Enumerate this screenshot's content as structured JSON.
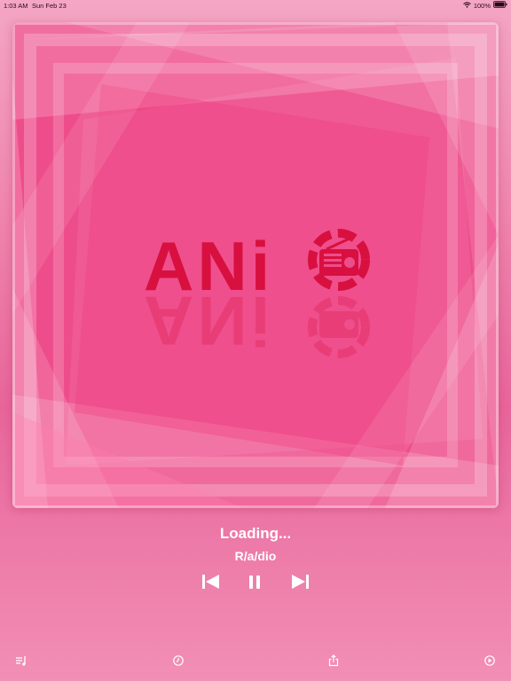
{
  "status_bar": {
    "time": "1:03 AM",
    "date": "Sun Feb 23",
    "battery": "100%"
  },
  "artwork": {
    "logo_text": "ANi",
    "accent_color": "#d8103f",
    "background_color": "#ee4d8b"
  },
  "now_playing": {
    "title": "Loading...",
    "artist": "R/a/dio"
  },
  "controls": {
    "icons": [
      "previous-track-icon",
      "pause-icon",
      "next-track-icon"
    ]
  },
  "bottom_bar": {
    "icons": [
      "queue-icon",
      "sleep-timer-icon",
      "share-icon",
      "airplay-icon"
    ]
  }
}
